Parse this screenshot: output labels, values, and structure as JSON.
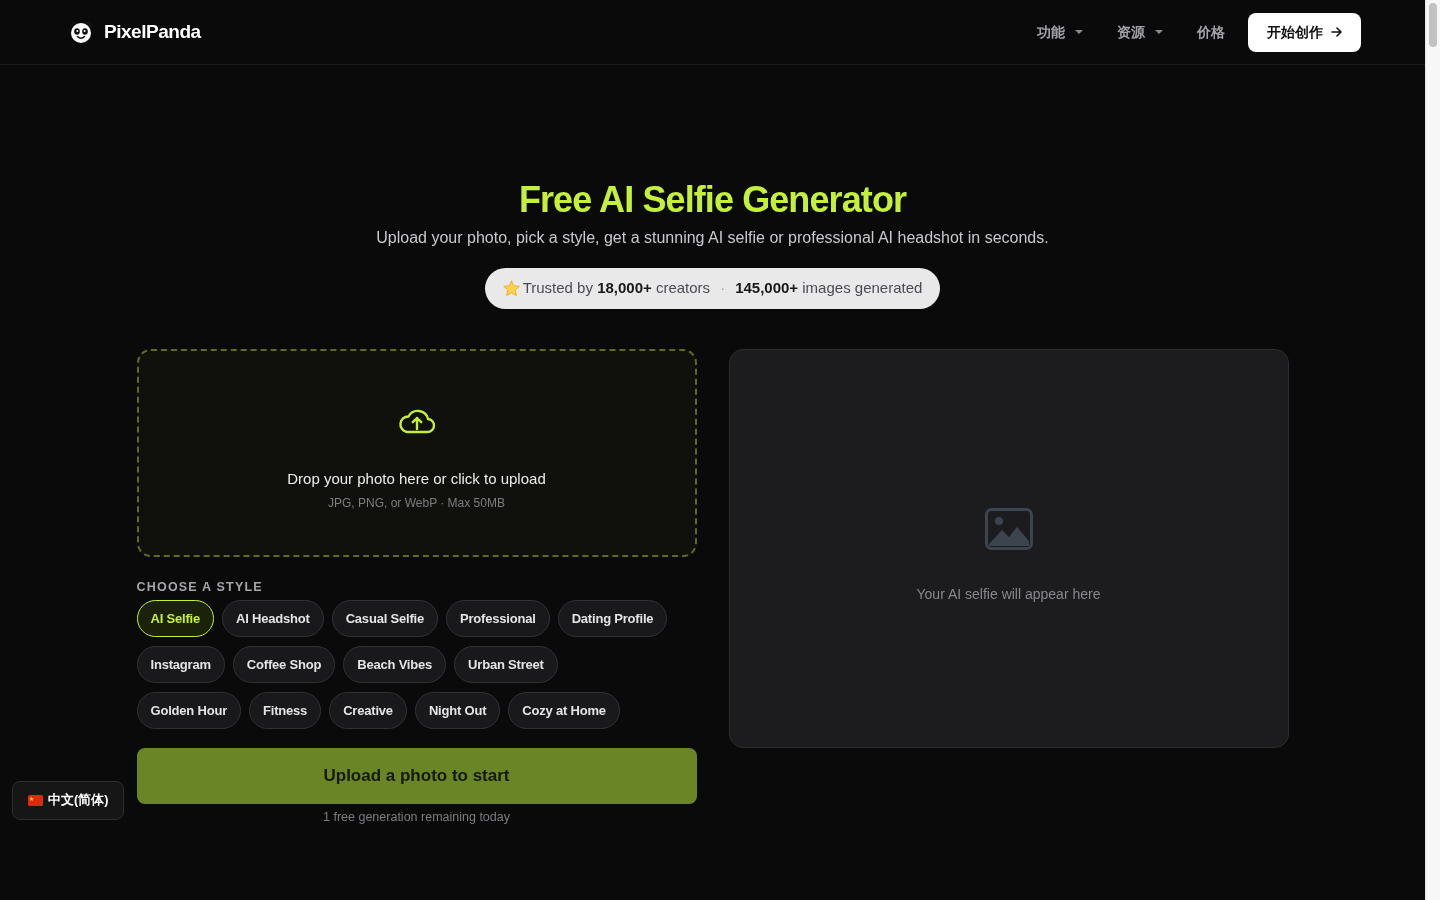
{
  "header": {
    "brand": "PixelPanda",
    "nav": [
      {
        "label": "功能",
        "kind": "dropdown"
      },
      {
        "label": "资源",
        "kind": "dropdown"
      },
      {
        "label": "价格",
        "kind": "link"
      }
    ],
    "cta": "开始创作"
  },
  "hero": {
    "title": "Free AI Selfie Generator",
    "subtitle": "Upload your photo, pick a style, get a stunning AI selfie or professional AI headshot in seconds.",
    "trust": [
      "Trusted by **18,000+** creators",
      "**145,000+** images generated"
    ],
    "separator": "·"
  },
  "upload": {
    "title": "Drop your photo here or click to upload",
    "hint": "JPG, PNG, or WebP · Max 50MB"
  },
  "styles": {
    "label": "CHOOSE A STYLE",
    "rows": [
      [
        {
          "label": "AI Selfie",
          "selected": true
        },
        {
          "label": "AI Headshot",
          "selected": false
        },
        {
          "label": "Casual Selfie",
          "selected": false
        },
        {
          "label": "Professional",
          "selected": false
        },
        {
          "label": "Dating Profile",
          "selected": false
        }
      ],
      [
        {
          "label": "Instagram",
          "selected": false
        },
        {
          "label": "Coffee Shop",
          "selected": false
        },
        {
          "label": "Beach Vibes",
          "selected": false
        },
        {
          "label": "Urban Street",
          "selected": false
        }
      ],
      [
        {
          "label": "Golden Hour",
          "selected": false
        },
        {
          "label": "Fitness",
          "selected": false
        },
        {
          "label": "Creative",
          "selected": false
        },
        {
          "label": "Night Out",
          "selected": false
        },
        {
          "label": "Cozy at Home",
          "selected": false
        }
      ]
    ]
  },
  "generate": {
    "label": "Upload a photo to start",
    "note": "1 free generation remaining today"
  },
  "preview": {
    "message": "Your AI selfie will appear here"
  },
  "language": {
    "label": "中文(简体)"
  }
}
